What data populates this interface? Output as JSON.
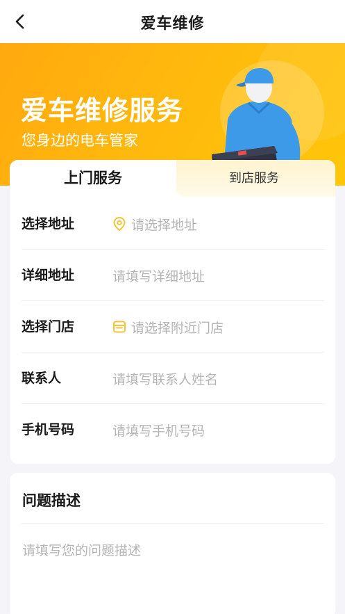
{
  "nav": {
    "title": "爱车维修",
    "back_icon": "chevron-left-icon"
  },
  "banner": {
    "headline": "爱车维修服务",
    "subtitle": "您身边的电车管家",
    "illustration": "delivery-worker-illustration",
    "gradient": [
      "#ffa90f",
      "#ffc60a"
    ]
  },
  "tabs": [
    {
      "label": "上门服务",
      "active": true
    },
    {
      "label": "到店服务",
      "active": false
    }
  ],
  "form": {
    "rows": [
      {
        "label": "选择地址",
        "placeholder": "请选择地址",
        "icon": "location-pin-icon"
      },
      {
        "label": "详细地址",
        "placeholder": "请填写详细地址"
      },
      {
        "label": "选择门店",
        "placeholder": "请选择附近门店",
        "icon": "store-icon"
      },
      {
        "label": "联系人",
        "placeholder": "请填写联系人姓名"
      },
      {
        "label": "手机号码",
        "placeholder": "请填写手机号码"
      }
    ]
  },
  "description": {
    "title": "问题描述",
    "placeholder": "请填写您的问题描述"
  },
  "colors": {
    "accent": "#f5c338",
    "placeholder": "#b5b5b5",
    "text": "#1a1a1a"
  }
}
